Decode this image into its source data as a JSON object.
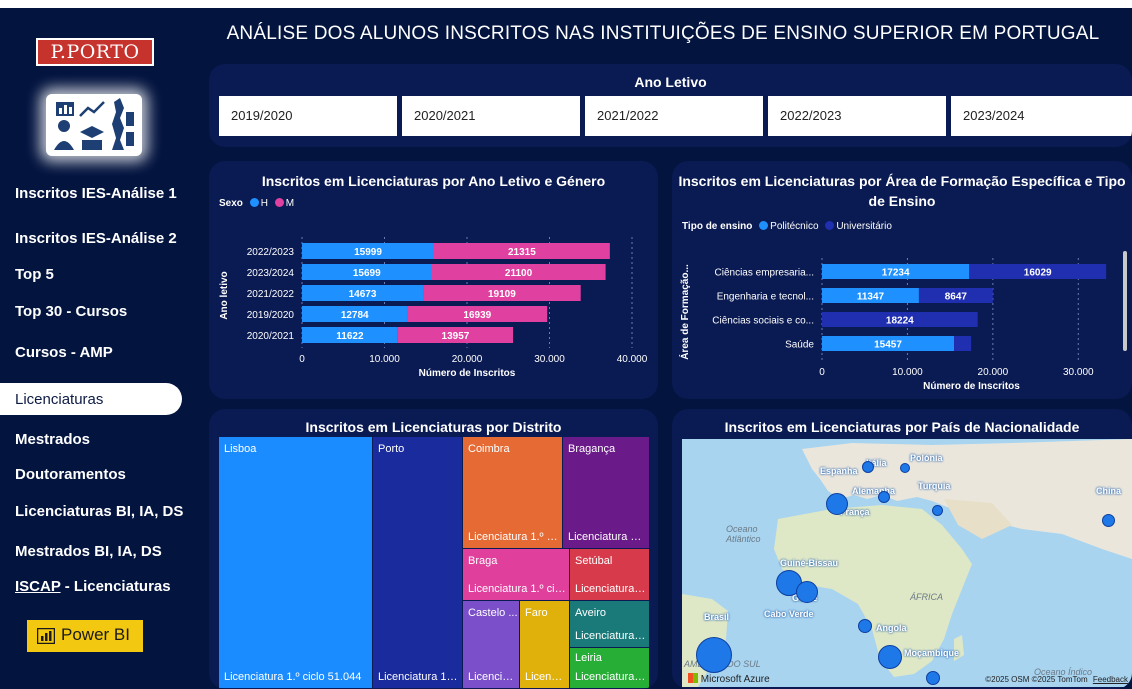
{
  "header": {
    "title": "ANÁLISE DOS ALUNOS INSCRITOS NAS INSTITUIÇÕES DE ENSINO SUPERIOR EM PORTUGAL"
  },
  "sidebar": {
    "brand": "P.PORTO",
    "items": [
      {
        "label": "Inscritos IES-Análise 1"
      },
      {
        "label": "Inscritos IES-Análise 2"
      },
      {
        "label": "Top 5"
      },
      {
        "label": "Top 30 - Cursos"
      },
      {
        "label": "Cursos - AMP"
      },
      {
        "label": "Licenciaturas"
      },
      {
        "label": "Mestrados"
      },
      {
        "label": "Doutoramentos"
      },
      {
        "label": "Licenciaturas BI, IA, DS"
      },
      {
        "label": "Mestrados BI, IA, DS"
      }
    ],
    "iscap_prefix": "ISCAP",
    "iscap_suffix": " - Licenciaturas",
    "powerbi_label": "Power BI"
  },
  "slicer": {
    "title": "Ano Letivo",
    "options": [
      "2019/2020",
      "2020/2021",
      "2021/2022",
      "2022/2023",
      "2023/2024"
    ]
  },
  "chart_gender": {
    "title": "Inscritos em Licenciaturas por Ano Letivo e Género",
    "legend_title": "Sexo",
    "legend": [
      {
        "name": "H",
        "color": "#1e90ff"
      },
      {
        "name": "M",
        "color": "#e040a0"
      }
    ]
  },
  "chart_area": {
    "title_line1": "Inscritos em Licenciaturas por Área de Formação Específica e Tipo",
    "title_line2": "de Ensino",
    "legend_title": "Tipo de ensino",
    "legend": [
      {
        "name": "Politécnico",
        "color": "#1e90ff"
      },
      {
        "name": "Universitário",
        "color": "#1f2fb0"
      }
    ]
  },
  "treemap": {
    "title": "Inscritos em Licenciaturas por Distrito",
    "cells": [
      {
        "name": "Lisboa",
        "label": "Licenciatura 1.º ciclo 51.044",
        "color": "#1a8cff"
      },
      {
        "name": "Porto",
        "label": "Licenciatura 1.º...",
        "color": "#1a2b9e"
      },
      {
        "name": "Coimbra",
        "label": "Licenciatura 1.º ci...",
        "color": "#e56a33"
      },
      {
        "name": "Bragança",
        "label": "Licenciatura 1....",
        "color": "#6b1a8a"
      },
      {
        "name": "Braga",
        "label": "Licenciatura 1.º cicl...",
        "color": "#e0409c"
      },
      {
        "name": "Setúbal",
        "label": "Licenciatura ...",
        "color": "#d73b4b"
      },
      {
        "name": "Castelo ...",
        "label": "Licenciat...",
        "color": "#7a4fc9"
      },
      {
        "name": "Faro",
        "label": "Licenci...",
        "color": "#e0b10a"
      },
      {
        "name": "Aveiro",
        "label": "Licenciatura ...",
        "color": "#1a7a7a"
      },
      {
        "name": "Leiria",
        "label": "Licenciatura ...",
        "color": "#27ae36"
      }
    ]
  },
  "map": {
    "title": "Inscritos em Licenciaturas por País de Nacionalidade",
    "countries": [
      "Espanha",
      "Itália",
      "Polónia",
      "Alemanha",
      "Turquia",
      "França",
      "China",
      "Guiné-Bissau",
      "Guiné",
      "Cabo Verde",
      "Brasil",
      "Angola",
      "Moçambique"
    ],
    "geo_labels": [
      "Oceano Atlântico",
      "ÁFRICA",
      "AMÉRICA DO SUL",
      "Oceano Índico"
    ],
    "attribution": "©2025 OSM  ©2025 TomTom",
    "feedback": "Feedback",
    "provider": "Microsoft Azure"
  },
  "chart_data": [
    {
      "type": "bar",
      "stacked": true,
      "orientation": "horizontal",
      "title": "Inscritos em Licenciaturas por Ano Letivo e Género",
      "xlabel": "Número de Inscritos",
      "ylabel": "Ano letivo",
      "legend_title": "Sexo",
      "legend_position": "top-left",
      "categories": [
        "2022/2023",
        "2023/2024",
        "2021/2022",
        "2019/2020",
        "2020/2021"
      ],
      "series": [
        {
          "name": "H",
          "values": [
            15999,
            15699,
            14673,
            12784,
            11622
          ],
          "color": "#1e90ff"
        },
        {
          "name": "M",
          "values": [
            21315,
            21100,
            19109,
            16939,
            13957
          ],
          "color": "#e040a0"
        }
      ],
      "xlim": [
        0,
        40000
      ],
      "xticks": [
        "0",
        "10.000",
        "20.000",
        "30.000",
        "40.000"
      ],
      "grid": true
    },
    {
      "type": "bar",
      "stacked": true,
      "orientation": "horizontal",
      "title": "Inscritos em Licenciaturas por Área de Formação Específica e Tipo de Ensino",
      "xlabel": "Número de Inscritos",
      "ylabel": "Área de Formação...",
      "legend_title": "Tipo de ensino",
      "legend_position": "top-left",
      "categories": [
        "Ciências empresaria...",
        "Engenharia e tecnol...",
        "Ciências sociais e co...",
        "Saúde"
      ],
      "series": [
        {
          "name": "Politécnico",
          "values": [
            17234,
            11347,
            null,
            15457
          ],
          "color": "#1e90ff"
        },
        {
          "name": "Universitário",
          "values": [
            16029,
            8647,
            18224,
            2000
          ],
          "color": "#1f2fb0"
        }
      ],
      "xlim": [
        0,
        35000
      ],
      "xticks": [
        "0",
        "10.000",
        "20.000",
        "30.000"
      ],
      "grid": true
    }
  ]
}
